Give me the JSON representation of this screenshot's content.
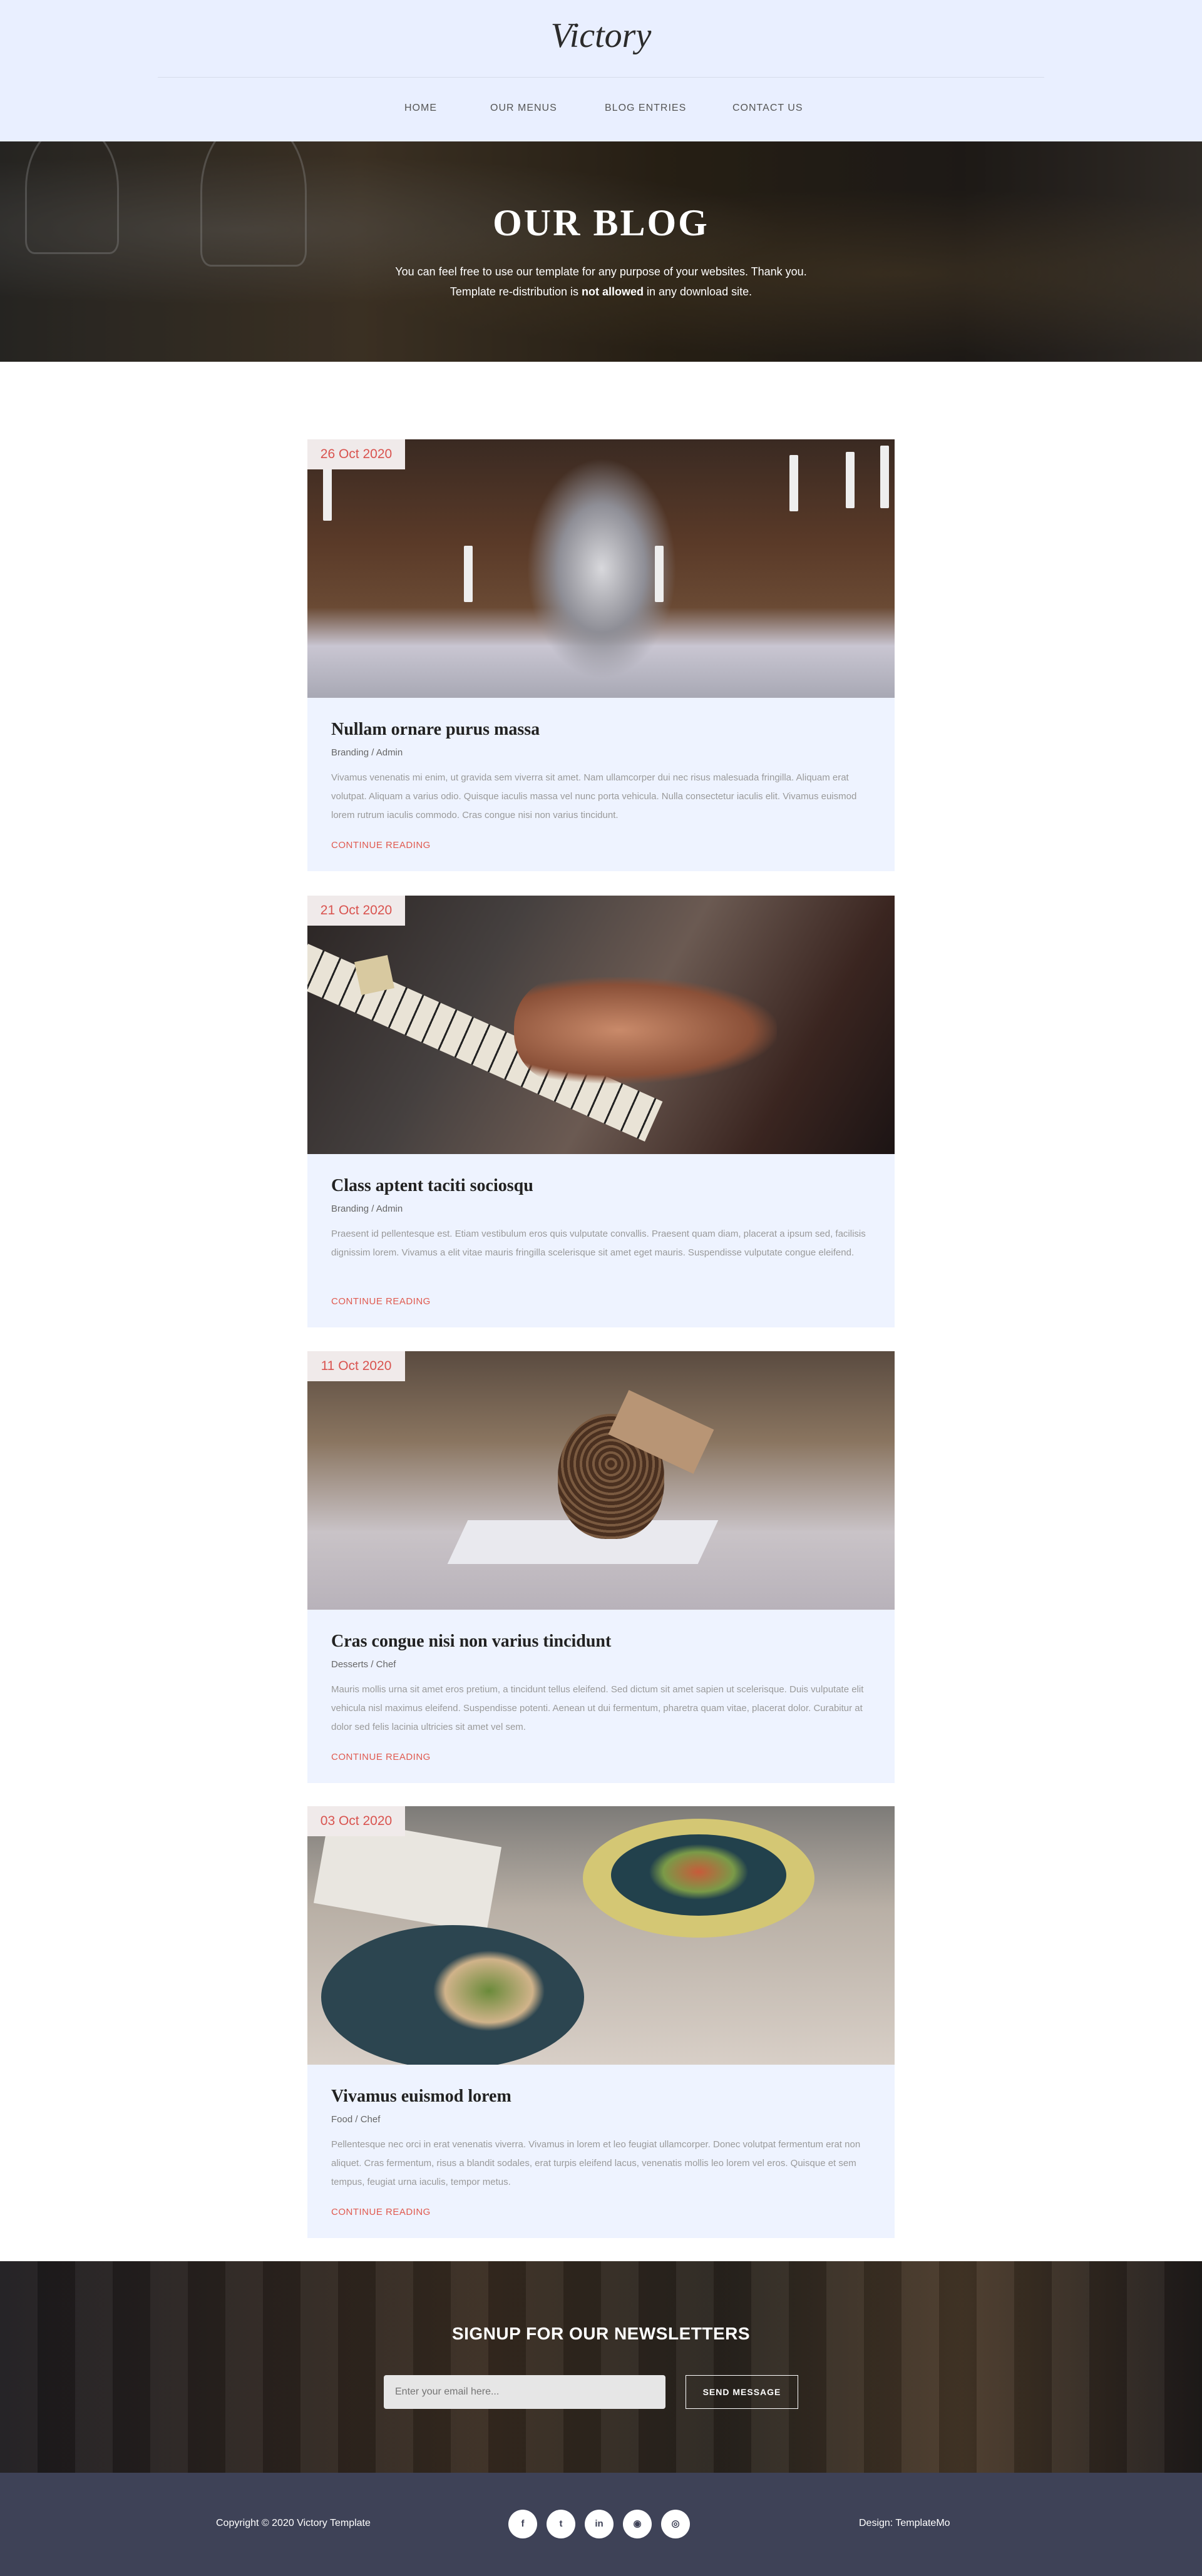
{
  "site": {
    "logo": "Victory"
  },
  "nav": {
    "items": [
      "HOME",
      "OUR MENUS",
      "BLOG ENTRIES",
      "CONTACT US"
    ]
  },
  "hero": {
    "title": "OUR BLOG",
    "line1": "You can feel free to use our template for any purpose of your websites. Thank you.",
    "line2_before": "Template re-distribution is ",
    "line2_bold": "not allowed",
    "line2_after": " in any download site."
  },
  "posts": [
    {
      "date": "26 Oct 2020",
      "title": "Nullam ornare purus massa",
      "meta": "Branding / Admin",
      "excerpt": "Vivamus venenatis mi enim, ut gravida sem viverra sit amet. Nam ullamcorper dui nec risus malesuada fringilla. Aliquam erat volutpat. Aliquam a varius odio. Quisque iaculis massa vel nunc porta vehicula. Nulla consectetur iaculis elit. Vivamus euismod lorem rutrum iaculis commodo. Cras congue nisi non varius tincidunt.",
      "link": "CONTINUE READING"
    },
    {
      "date": "21 Oct 2020",
      "title": "Class aptent taciti sociosqu",
      "meta": "Branding / Admin",
      "excerpt": "Praesent id pellentesque est. Etiam vestibulum eros quis vulputate convallis. Praesent quam diam, placerat a ipsum sed, facilisis dignissim lorem. Vivamus a elit vitae mauris fringilla scelerisque sit amet eget mauris. Suspendisse vulputate congue eleifend.",
      "link": "CONTINUE READING"
    },
    {
      "date": "11 Oct 2020",
      "title": "Cras congue nisi non varius tincidunt",
      "meta": "Desserts / Chef",
      "excerpt": "Mauris mollis urna sit amet eros pretium, a tincidunt tellus eleifend. Sed dictum sit amet sapien ut scelerisque. Duis vulputate elit vehicula nisl maximus eleifend. Suspendisse potenti. Aenean ut dui fermentum, pharetra quam vitae, placerat dolor. Curabitur at dolor sed felis lacinia ultricies sit amet vel sem.",
      "link": "CONTINUE READING"
    },
    {
      "date": "03 Oct 2020",
      "title": "Vivamus euismod lorem",
      "meta": "Food / Chef",
      "excerpt": "Pellentesque nec orci in erat venenatis viverra. Vivamus in lorem et leo feugiat ullamcorper. Donec volutpat fermentum erat non aliquet. Cras fermentum, risus a blandit sodales, erat turpis eleifend lacus, venenatis mollis leo lorem vel eros. Quisque et sem tempus, feugiat urna iaculis, tempor metus.",
      "link": "CONTINUE READING"
    }
  ],
  "newsletter": {
    "title": "SIGNUP FOR OUR NEWSLETTERS",
    "placeholder": "Enter your email here...",
    "button": "SEND MESSAGE"
  },
  "footer": {
    "copyright": "Copyright © 2020 Victory Template",
    "designer": "Design: TemplateMo",
    "socials": [
      {
        "icon": "facebook-icon",
        "glyph": "f"
      },
      {
        "icon": "twitter-icon",
        "glyph": "t"
      },
      {
        "icon": "linkedin-icon",
        "glyph": "in"
      },
      {
        "icon": "rss-icon",
        "glyph": "◉"
      },
      {
        "icon": "dribbble-icon",
        "glyph": "◎"
      }
    ]
  },
  "colors": {
    "accent": "#e05a4f",
    "header_bg": "#e9efff",
    "post_bg": "#eef3ff",
    "footer_bg": "#3e4257"
  }
}
